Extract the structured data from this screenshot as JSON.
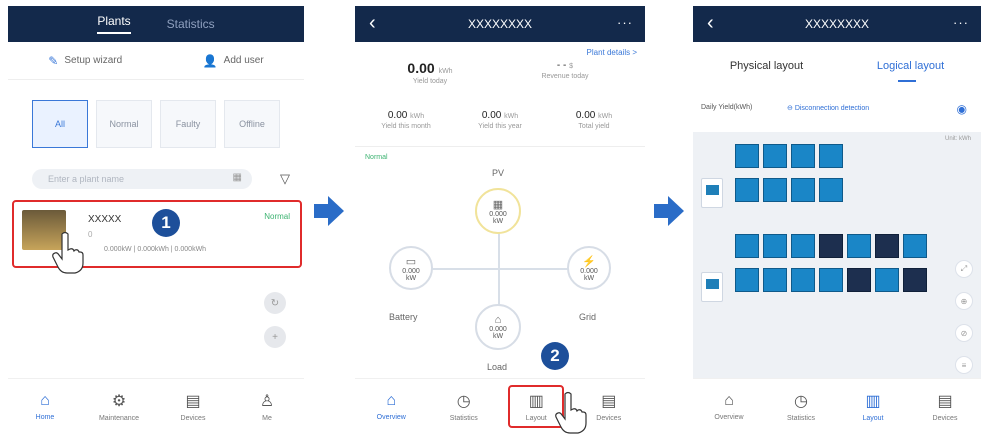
{
  "screen1": {
    "tabs": [
      "Plants",
      "Statistics"
    ],
    "setup_wizard": "Setup wizard",
    "add_user": "Add user",
    "filters": [
      "All",
      "Normal",
      "Faulty",
      "Offline"
    ],
    "search_placeholder": "Enter a plant name",
    "plant": {
      "name": "XXXXX",
      "sub": "0",
      "status": "Normal",
      "metrics": "0.000kW  |  0.000kWh  |  0.000kWh"
    },
    "step": "1",
    "nav": [
      "Home",
      "Maintenance",
      "Devices",
      "Me"
    ]
  },
  "screen2": {
    "title": "XXXXXXXX",
    "more": "···",
    "plant_details": "Plant details >",
    "yield_today": {
      "value": "0.00",
      "unit": "kWh",
      "label": "Yield today"
    },
    "revenue_today": {
      "value": "- -",
      "unit": "$",
      "label": "Revenue today"
    },
    "yield_month": {
      "value": "0.00",
      "unit": "kWh",
      "label": "Yield this month"
    },
    "yield_year": {
      "value": "0.00",
      "unit": "kWh",
      "label": "Yield this year"
    },
    "total_yield": {
      "value": "0.00",
      "unit": "kWh",
      "label": "Total yield"
    },
    "status": "Normal",
    "nodes": {
      "pv": {
        "label": "PV",
        "value": "0.000",
        "unit": "kW"
      },
      "battery": {
        "label": "Battery",
        "value": "0.000",
        "unit": "kW"
      },
      "grid": {
        "label": "Grid",
        "value": "0.000",
        "unit": "kW"
      },
      "load": {
        "label": "Load",
        "value": "0.000",
        "unit": "kW"
      }
    },
    "step": "2",
    "nav": [
      "Overview",
      "Statistics",
      "Layout",
      "Devices"
    ]
  },
  "screen3": {
    "title": "XXXXXXXX",
    "more": "···",
    "tabs": [
      "Physical layout",
      "Logical layout"
    ],
    "daily_yield": "Daily Yield(kWh)",
    "disconnection": "Disconnection detection",
    "unit": "Unit: kWh",
    "nav": [
      "Overview",
      "Statistics",
      "Layout",
      "Devices"
    ]
  },
  "colors": {
    "header": "#13294b",
    "accent": "#2f6fd6",
    "highlight": "#e02b2b",
    "step_badge": "#1d4f9a",
    "panel": "#1a86c7"
  }
}
